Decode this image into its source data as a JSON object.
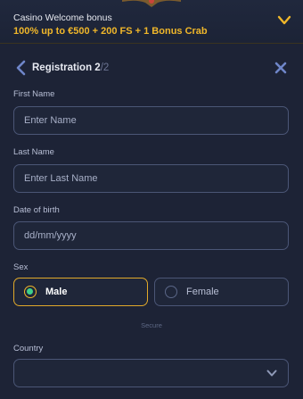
{
  "banner": {
    "title": "Casino Welcome bonus",
    "offer": "100% up to €500 + 200 FS + 1 Bonus Crab",
    "accent_color": "#f0b72a"
  },
  "header": {
    "title": "Registration 2",
    "step_total": "/2"
  },
  "form": {
    "first_name": {
      "label": "First Name",
      "placeholder": "Enter Name",
      "value": ""
    },
    "last_name": {
      "label": "Last Name",
      "placeholder": "Enter Last Name",
      "value": ""
    },
    "dob": {
      "label": "Date of birth",
      "placeholder": "dd/mm/yyyy",
      "value": ""
    },
    "sex": {
      "label": "Sex",
      "options": [
        "Male",
        "Female"
      ],
      "selected": "Male"
    },
    "secure_note": "Secure",
    "country": {
      "label": "Country",
      "value": ""
    }
  },
  "icons": {
    "banner_toggle": "chevron-down-icon",
    "back": "chevron-left-icon",
    "close": "close-icon",
    "country_select": "chevron-down-icon"
  }
}
